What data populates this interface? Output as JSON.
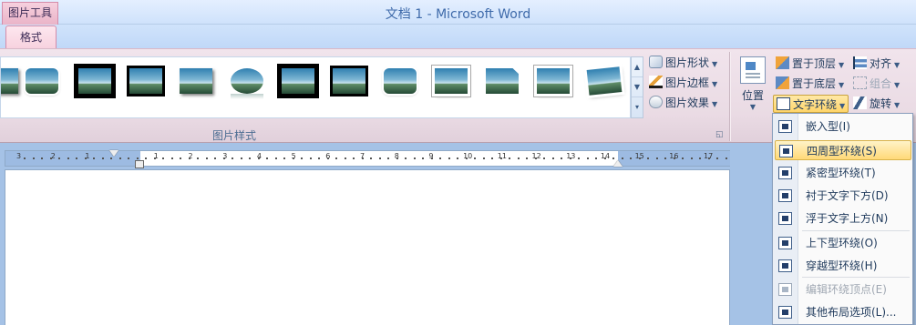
{
  "titlebar": {
    "context_group": "图片工具",
    "window_title": "文档 1 - Microsoft Word"
  },
  "tabs": {
    "format": "格式"
  },
  "ribbon": {
    "picture_styles_group": "图片样式",
    "picture_shape": "图片形状",
    "picture_border": "图片边框",
    "picture_effects": "图片效果",
    "position": "位置",
    "bring_to_front": "置于顶层",
    "send_to_back": "置于底层",
    "text_wrapping": "文字环绕",
    "align": "对齐",
    "group": "组合",
    "rotate": "旋转"
  },
  "ruler": {
    "ticks": [
      "3",
      "2",
      "1",
      "1",
      "2",
      "3",
      "4",
      "5",
      "6",
      "7",
      "8",
      "9",
      "10",
      "11",
      "12",
      "13",
      "14",
      "15",
      "16",
      "17"
    ]
  },
  "wrap_menu": {
    "items": [
      {
        "label": "嵌入型(I)"
      },
      {
        "label": "四周型环绕(S)"
      },
      {
        "label": "紧密型环绕(T)"
      },
      {
        "label": "衬于文字下方(D)"
      },
      {
        "label": "浮于文字上方(N)"
      },
      {
        "label": "上下型环绕(O)"
      },
      {
        "label": "穿越型环绕(H)"
      },
      {
        "label": "编辑环绕顶点(E)"
      },
      {
        "label": "其他布局选项(L)..."
      }
    ],
    "highlighted_index": 1,
    "disabled_index": 7
  },
  "colors": {
    "context_tab": "#eab4c8",
    "highlight": "#ffd978",
    "ribbon_bg": "#eadbe4"
  }
}
